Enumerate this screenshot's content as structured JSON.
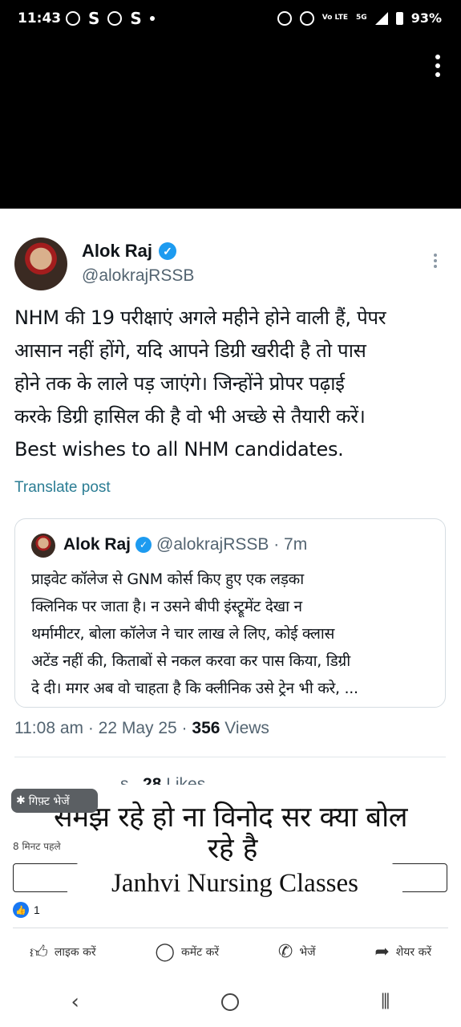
{
  "status_bar": {
    "time": "11:43",
    "left_icons": [
      "whatsapp-icon",
      "S",
      "cb",
      "S",
      "dot"
    ],
    "right_icons": [
      "alarm-icon",
      "dnd-icon",
      "volte-icon"
    ],
    "network": "5G",
    "battery": "93%",
    "volte": "Vo LTE"
  },
  "post": {
    "author": {
      "name": "Alok Raj",
      "handle": "@alokrajRSSB",
      "verified": true
    },
    "body_lines": [
      "NHM की 19 परीक्षाएं अगले महीने होने वाली हैं, पेपर",
      "आसान नहीं होंगे, यदि आपने डिग्री खरीदी है तो पास",
      "होने तक के लाले पड़ जाएंगे। जिन्होंने प्रोपर पढ़ाई",
      "करके डिग्री हासिल की है वो भी अच्छे से तैयारी करें।",
      "Best wishes to all NHM candidates."
    ],
    "translate_label": "Translate post",
    "quote": {
      "name": "Alok Raj",
      "handle": "@alokrajRSSB · 7m",
      "body_lines": [
        "प्राइवेट कॉलेज से GNM कोर्स किए हुए एक लड़का",
        "क्लिनिक पर जाता है। न उसने बीपी इंस्ट्रूमेंट देखा न",
        "थर्मामीटर,  बोला कॉलेज ने चार लाख ले लिए, कोई क्लास",
        "अटेंड नहीं की, किताबों से नकल करवा कर पास किया, डिग्री",
        "दे दी। मगर अब वो चाहता है कि क्लीनिक उसे ट्रेन भी करे, ..."
      ]
    },
    "meta": {
      "time": "11:08 am · 22 May 25 · ",
      "views_count": "356",
      "views_label": " Views"
    },
    "likes": {
      "prefix": "s",
      "count": "28",
      "label": " Likes"
    }
  },
  "overlay": {
    "gift_label": "गिफ़्ट भेजें",
    "time_ago": "8 मिनट पहले",
    "caption_line1": "समझ रहे हो ना विनोद सर क्या बोल",
    "caption_line2": "रहे है",
    "caption_brand": "Janhvi Nursing Classes"
  },
  "reactions": {
    "count": "1"
  },
  "actions": {
    "like": "लाइक करें",
    "comment": "कमेंट करें",
    "send": "भेजें",
    "share": "शेयर करें"
  },
  "colors": {
    "accent": "#1d9bf0",
    "fb_blue": "#1877f2",
    "translate": "#2b7d94"
  }
}
